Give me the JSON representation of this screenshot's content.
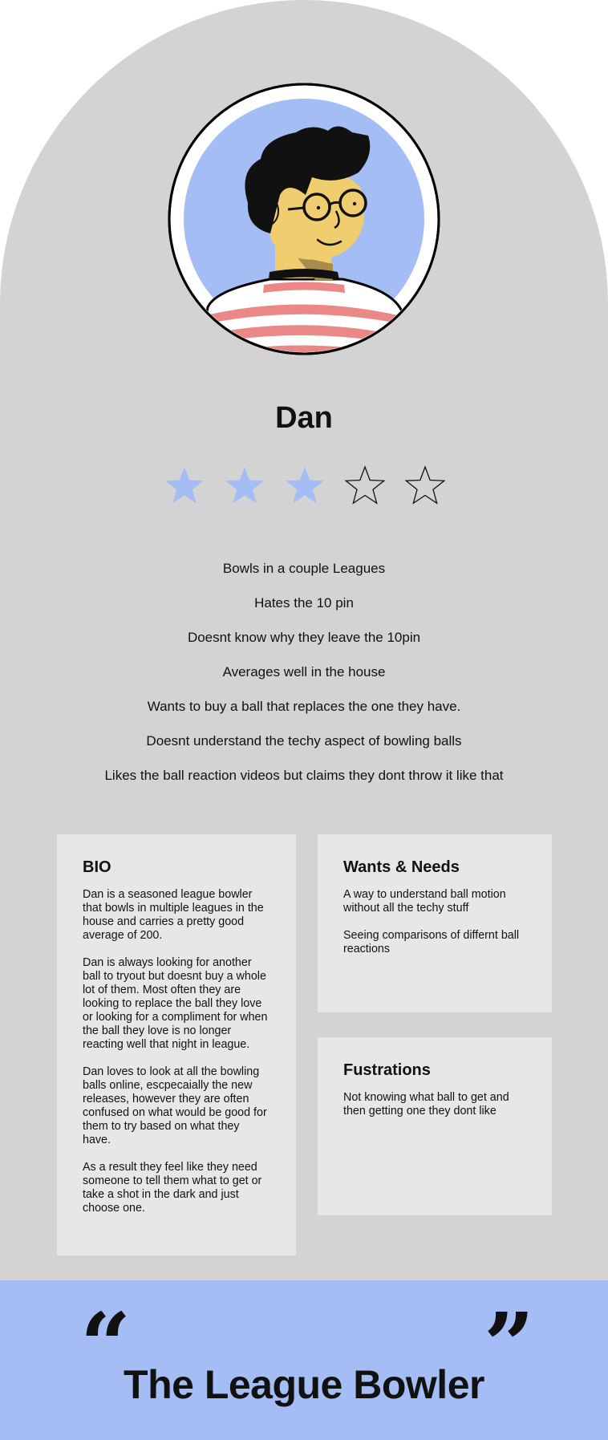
{
  "persona": {
    "name": "Dan",
    "rating": {
      "value": 3,
      "max": 5,
      "filled_color": "#a4bef5"
    },
    "traits": [
      "Bowls in a couple Leagues",
      "Hates the 10 pin",
      "Doesnt know why they leave the 10pin",
      "Averages well in the house",
      "Wants to buy a ball that replaces the one they have.",
      "Doesnt understand the techy aspect of bowling balls",
      "Likes the ball reaction videos but claims they dont throw it like that"
    ]
  },
  "bio": {
    "title": "BIO",
    "paragraphs": [
      "Dan is a seasoned league bowler that bowls in multiple leagues in the house and carries a pretty good average of 200.",
      "Dan is always looking for another ball to tryout but doesnt buy a whole lot of them. Most often they are looking to replace the ball they love or looking for a compliment for when the ball they love is no longer reacting well that night in league.",
      "Dan loves to look at all the bowling balls online, escpecaially the new releases, however they are often confused on what would be good for them to try based on what they have.",
      "As a result they feel like they need someone to tell them what to get or take a shot in the dark and just choose one."
    ]
  },
  "wants_needs": {
    "title": "Wants & Needs",
    "paragraphs": [
      "A way to understand ball motion without all the techy stuff",
      "Seeing comparisons of differnt ball reactions"
    ]
  },
  "frustrations": {
    "title": "Fustrations",
    "paragraphs": [
      "Not knowing what ball to get and then getting one they dont like"
    ]
  },
  "quote": {
    "open_mark": "“",
    "close_mark": "”",
    "text": "The League Bowler"
  },
  "colors": {
    "arch_bg": "#d3d3d3",
    "card_bg": "#e7e7e7",
    "accent_blue": "#a4bef5",
    "shirt_stripe": "#ea8888",
    "skin": "#f0ce70"
  },
  "icons": [
    "avatar-illustration",
    "star-icon-filled",
    "star-icon-outline"
  ]
}
